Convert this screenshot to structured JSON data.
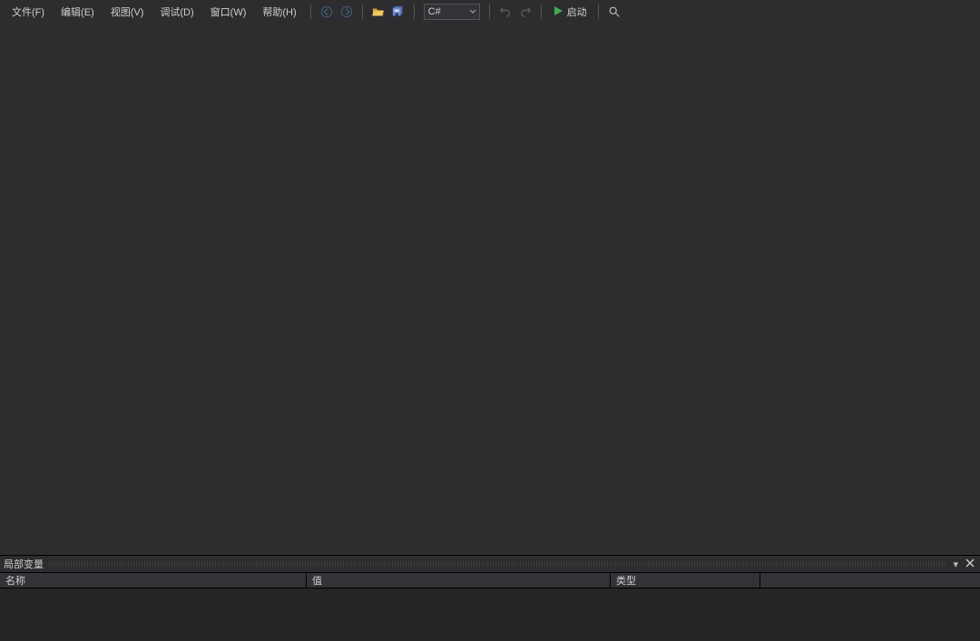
{
  "menus": {
    "file": "文件(F)",
    "edit": "编辑(E)",
    "view": "视图(V)",
    "debug": "调试(D)",
    "window": "窗口(W)",
    "help": "帮助(H)"
  },
  "toolbar": {
    "language_selected": "C#",
    "start_label": "启动"
  },
  "panel": {
    "title": "局部变量",
    "columns": {
      "name": "名称",
      "value": "值",
      "type": "类型"
    }
  }
}
